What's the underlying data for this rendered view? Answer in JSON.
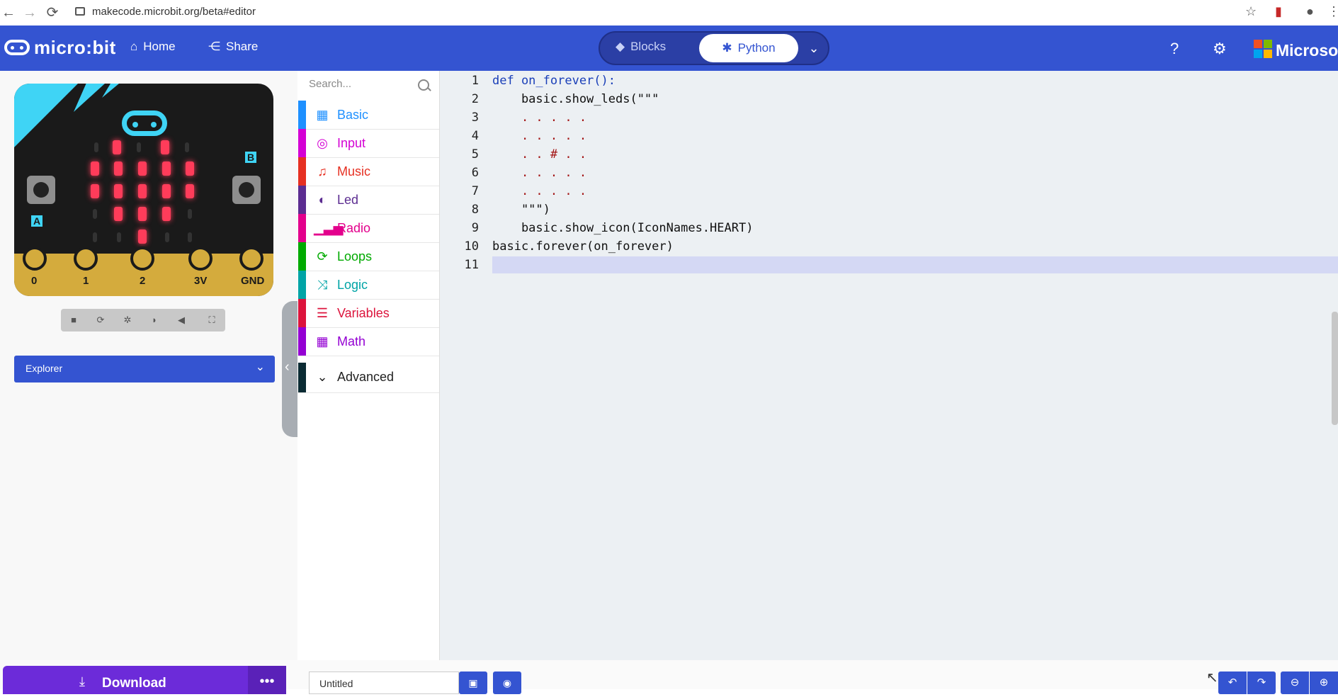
{
  "browser": {
    "url": "makecode.microbit.org/beta#editor"
  },
  "header": {
    "brand": "micro:bit",
    "home_label": "Home",
    "share_label": "Share",
    "mode_blocks": "Blocks",
    "mode_python": "Python",
    "microsoft": "Microsoft",
    "accent": "#3454D1"
  },
  "simulator": {
    "pins": [
      "0",
      "1",
      "2",
      "3V",
      "GND"
    ],
    "button_a": "A",
    "button_b": "B",
    "explorer_label": "Explorer"
  },
  "toolbox": {
    "search_placeholder": "Search...",
    "categories": [
      {
        "name": "Basic",
        "color": "#1E90FF",
        "icon": "grid-icon"
      },
      {
        "name": "Input",
        "color": "#D400D4",
        "icon": "target-icon"
      },
      {
        "name": "Music",
        "color": "#E63022",
        "icon": "headphones-icon"
      },
      {
        "name": "Led",
        "color": "#5C2D91",
        "icon": "toggle-icon"
      },
      {
        "name": "Radio",
        "color": "#E3008C",
        "icon": "signal-icon"
      },
      {
        "name": "Loops",
        "color": "#00AA00",
        "icon": "refresh-icon"
      },
      {
        "name": "Logic",
        "color": "#00A4A6",
        "icon": "shuffle-icon"
      },
      {
        "name": "Variables",
        "color": "#DC143C",
        "icon": "list-icon"
      },
      {
        "name": "Math",
        "color": "#9400D3",
        "icon": "calculator-icon"
      }
    ],
    "advanced_label": "Advanced"
  },
  "editor": {
    "line_numbers": [
      "1",
      "2",
      "3",
      "4",
      "5",
      "6",
      "7",
      "8",
      "9",
      "10",
      "11"
    ],
    "lines": [
      "def on_forever():",
      "    basic.show_leds(\"\"\"",
      "    . . . . .",
      "    . . . . .",
      "    . . # . .",
      "    . . . . .",
      "    . . . . .",
      "    \"\"\")",
      "    basic.show_icon(IconNames.HEART)",
      "basic.forever(on_forever)",
      ""
    ]
  },
  "footer": {
    "download_label": "Download",
    "project_name": "Untitled"
  }
}
